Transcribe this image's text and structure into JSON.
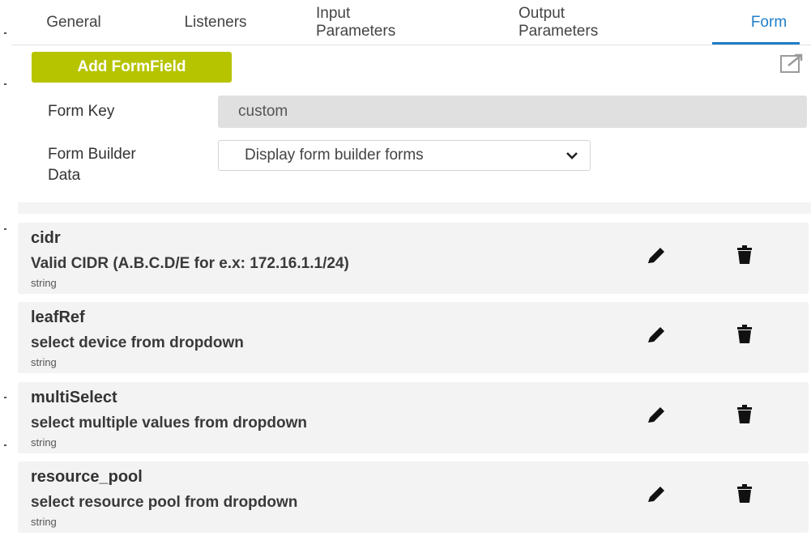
{
  "tabs": [
    {
      "label": "General"
    },
    {
      "label": "Listeners"
    },
    {
      "label_line1": "Input",
      "label_line2": "Parameters"
    },
    {
      "label_line1": "Output",
      "label_line2": "Parameters"
    },
    {
      "label": "Form",
      "active": true
    }
  ],
  "form": {
    "add_button_label": "Add FormField",
    "popout_icon": "open-in-new-icon",
    "form_key_label": "Form Key",
    "form_key_value": "custom",
    "builder_label_line1": "Form Builder",
    "builder_label_line2": "Data",
    "builder_select_value": "Display form builder forms"
  },
  "fields": [
    {
      "name": "cidr",
      "description": "Valid CIDR (A.B.C.D/E for e.x: 172.16.1.1/24)",
      "type": "string"
    },
    {
      "name": "leafRef",
      "description": "select device from dropdown",
      "type": "string"
    },
    {
      "name": "multiSelect",
      "description": "select multiple values from dropdown",
      "type": "string"
    },
    {
      "name": "resource_pool",
      "description": "select resource pool from dropdown",
      "type": "string"
    }
  ],
  "icons": {
    "edit": "pencil-icon",
    "delete": "trash-icon"
  },
  "colors": {
    "accent": "#1f7ec9",
    "add_button": "#b6c400",
    "card_bg": "#f3f3f3"
  }
}
